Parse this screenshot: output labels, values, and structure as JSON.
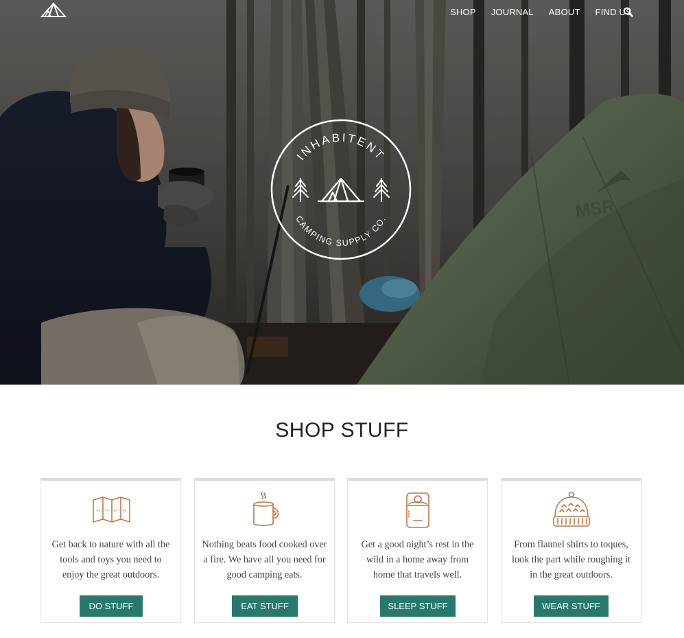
{
  "nav": {
    "logo_icon": "tent-logo-icon",
    "items": [
      {
        "label": "SHOP"
      },
      {
        "label": "JOURNAL"
      },
      {
        "label": "ABOUT"
      },
      {
        "label": "FIND US"
      }
    ],
    "search_icon": "search-icon"
  },
  "hero": {
    "badge_title": "INHABITENT",
    "badge_subtitle": "CAMPING SUPPLY CO.",
    "badge_icons": [
      "pine-tree-icon",
      "tent-icon",
      "pine-tree-icon"
    ],
    "tent_brand": "MSR"
  },
  "shop": {
    "heading": "SHOP STUFF",
    "cards": [
      {
        "icon": "map-icon",
        "text": "Get back to nature with all the tools and toys you need to enjoy the great outdoors.",
        "button": "DO STUFF"
      },
      {
        "icon": "mug-icon",
        "text": "Nothing beats food cooked over a fire. We have all you need for good camping eats.",
        "button": "EAT STUFF"
      },
      {
        "icon": "sleeping-bag-icon",
        "text": "Get a good night’s rest in the wild in a home away from home that travels well.",
        "button": "SLEEP STUFF"
      },
      {
        "icon": "toque-icon",
        "text": "From flannel shirts to toques, look the part while roughing it in the great outdoors.",
        "button": "WEAR STUFF"
      }
    ]
  },
  "colors": {
    "accent": "#277a6b",
    "icon": "#c9753f",
    "heading": "#222222",
    "body_text": "#444444",
    "card_border": "#e3e3e3"
  }
}
